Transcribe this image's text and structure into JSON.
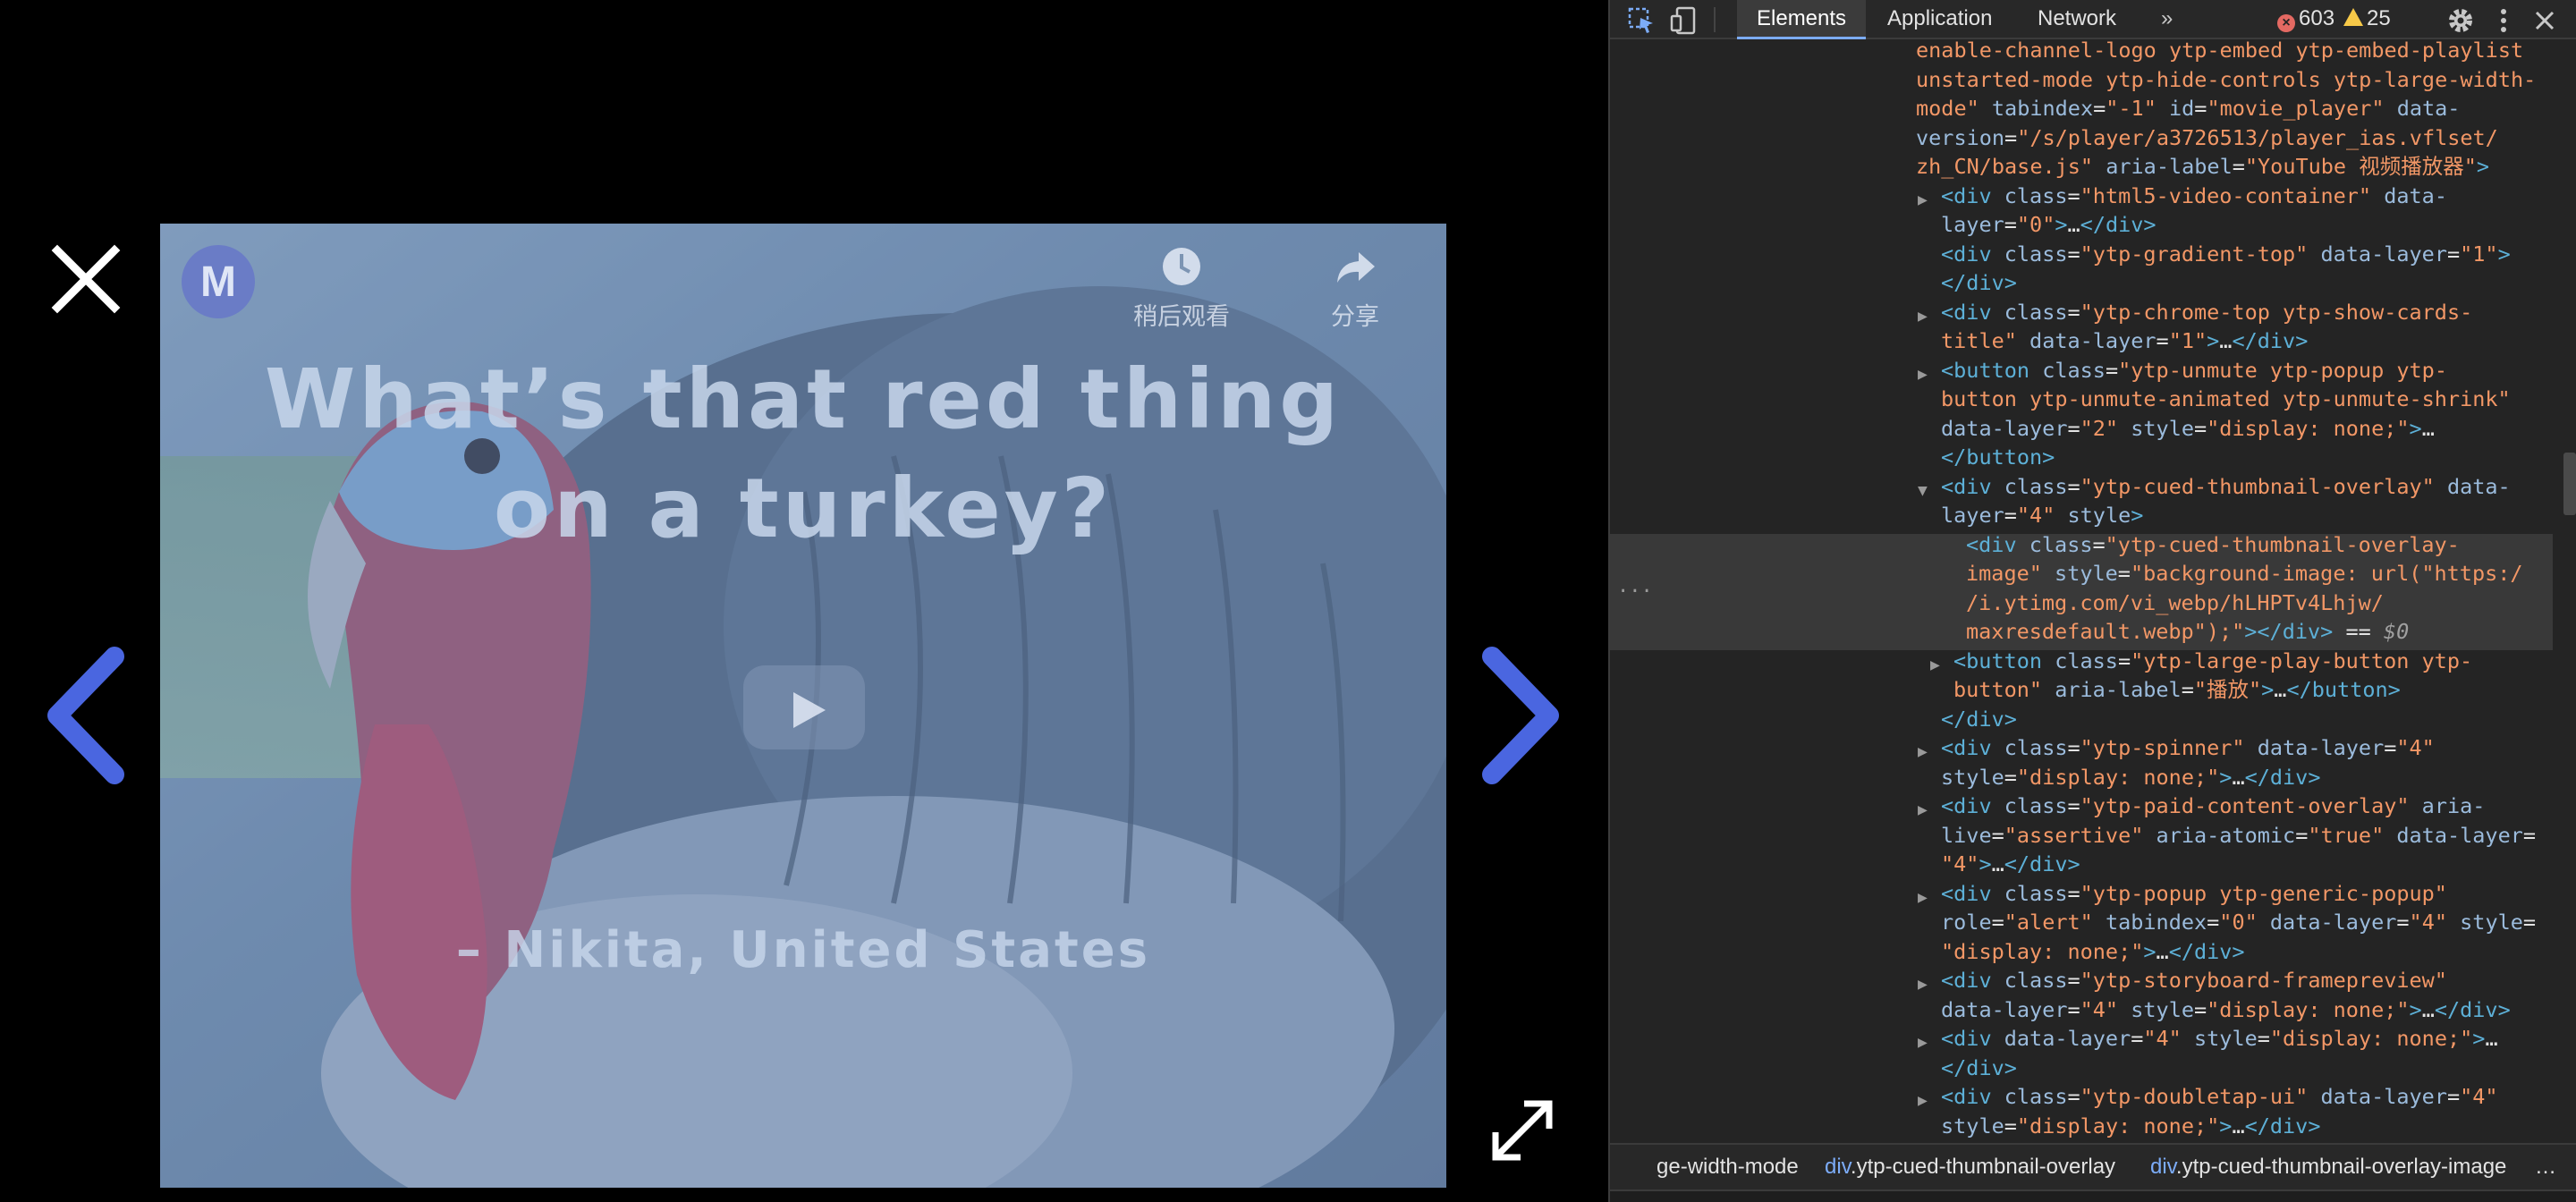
{
  "lightbox": {
    "video": {
      "title_line1": "What’s that red thing",
      "title_line2": "on a turkey?",
      "author": "– Nikita, United States",
      "channel_logo_letter": "M",
      "watch_later_label": "稍后观看",
      "share_label": "分享"
    },
    "icons": {
      "close": "close-icon",
      "prev": "chevron-left-icon",
      "next": "chevron-right-icon",
      "expand": "expand-icon",
      "watch_later": "clock-icon",
      "share": "share-icon",
      "play": "play-icon"
    },
    "colors": {
      "nav_accent": "#4a66e0",
      "close": "#ffffff"
    }
  },
  "devtools": {
    "tabs": [
      "Elements",
      "Application",
      "Network"
    ],
    "more_tabs": "»",
    "error_count": "603",
    "warning_count": "25",
    "lines": [
      {
        "html": "<span class='v'>enable-channel-logo ytp-embed ytp-embed-playlist</span>"
      },
      {
        "html": "<span class='v'>unstarted-mode ytp-hide-controls ytp-large-width-</span>"
      },
      {
        "html": "<span class='v'>mode\"</span> <span class='a'>tabindex</span><span class='p'>=</span><span class='v'>\"-1\"</span> <span class='a'>id</span><span class='p'>=</span><span class='v'>\"movie_player\"</span> <span class='a'>data-</span>"
      },
      {
        "html": "<span class='a'>version</span><span class='p'>=</span><span class='v'>\"/s/player/a3726513/player_ias.vflset/</span>"
      },
      {
        "html": "<span class='v'>zh_CN/base.js\"</span> <span class='a'>aria-label</span><span class='p'>=</span><span class='v'>\"YouTube 视频播放器\"</span><span class='t'>&gt;</span>"
      },
      {
        "html": "<span class='t'>&lt;div</span> <span class='a'>class</span><span class='p'>=</span><span class='v'>\"html5-video-container\"</span> <span class='a'>data-</span>"
      },
      {
        "html": "<span class='a'>layer</span><span class='p'>=</span><span class='v'>\"0\"</span><span class='t'>&gt;</span><span class='p'>…</span><span class='t'>&lt;/div&gt;</span>"
      },
      {
        "html": "<span class='t'>&lt;div</span> <span class='a'>class</span><span class='p'>=</span><span class='v'>\"ytp-gradient-top\"</span> <span class='a'>data-layer</span><span class='p'>=</span><span class='v'>\"1\"</span><span class='t'>&gt;</span>"
      },
      {
        "html": "<span class='t'>&lt;/div&gt;</span>"
      },
      {
        "html": "<span class='t'>&lt;div</span> <span class='a'>class</span><span class='p'>=</span><span class='v'>\"ytp-chrome-top ytp-show-cards-</span>"
      },
      {
        "html": "<span class='v'>title\"</span> <span class='a'>data-layer</span><span class='p'>=</span><span class='v'>\"1\"</span><span class='t'>&gt;</span><span class='p'>…</span><span class='t'>&lt;/div&gt;</span>"
      },
      {
        "html": "<span class='t'>&lt;button</span> <span class='a'>class</span><span class='p'>=</span><span class='v'>\"ytp-unmute ytp-popup ytp-</span>"
      },
      {
        "html": "<span class='v'>button ytp-unmute-animated ytp-unmute-shrink\"</span>"
      },
      {
        "html": "<span class='a'>data-layer</span><span class='p'>=</span><span class='v'>\"2\"</span> <span class='a'>style</span><span class='p'>=</span><span class='v'>\"display: none;\"</span><span class='t'>&gt;</span><span class='p'>…</span>"
      },
      {
        "html": "<span class='t'>&lt;/button&gt;</span>"
      },
      {
        "html": "<span class='t'>&lt;div</span> <span class='a'>class</span><span class='p'>=</span><span class='v'>\"ytp-cued-thumbnail-overlay\"</span> <span class='a'>data-</span>"
      },
      {
        "html": "<span class='a'>layer</span><span class='p'>=</span><span class='v'>\"4\"</span> <span class='a'>style</span><span class='t'>&gt;</span>"
      },
      {
        "html": "<span class='t'>&lt;div</span> <span class='a'>class</span><span class='p'>=</span><span class='v'>\"ytp-cued-thumbnail-overlay-</span>"
      },
      {
        "html": "<span class='v'>image\"</span> <span class='a'>style</span><span class='p'>=</span><span class='v'>\"background-image: url(\"https:/</span>"
      },
      {
        "html": "<span class='v'>/i.ytimg.com/vi_webp/hLHPTv4Lhjw/</span>"
      },
      {
        "html": "<span class='v'>maxresdefault.webp\");\"</span><span class='t'>&gt;&lt;/div&gt;</span> <span class='p'>==</span> <span class='g'>$0</span>"
      },
      {
        "html": "<span class='t'>&lt;button</span> <span class='a'>class</span><span class='p'>=</span><span class='v'>\"ytp-large-play-button ytp-</span>"
      },
      {
        "html": "<span class='v'>button\"</span> <span class='a'>aria-label</span><span class='p'>=</span><span class='v'>\"播放\"</span><span class='t'>&gt;</span><span class='p'>…</span><span class='t'>&lt;/button&gt;</span>"
      },
      {
        "html": "<span class='t'>&lt;/div&gt;</span>"
      },
      {
        "html": "<span class='t'>&lt;div</span> <span class='a'>class</span><span class='p'>=</span><span class='v'>\"ytp-spinner\"</span> <span class='a'>data-layer</span><span class='p'>=</span><span class='v'>\"4\"</span>"
      },
      {
        "html": "<span class='a'>style</span><span class='p'>=</span><span class='v'>\"display: none;\"</span><span class='t'>&gt;</span><span class='p'>…</span><span class='t'>&lt;/div&gt;</span>"
      },
      {
        "html": "<span class='t'>&lt;div</span> <span class='a'>class</span><span class='p'>=</span><span class='v'>\"ytp-paid-content-overlay\"</span> <span class='a'>aria-</span>"
      },
      {
        "html": "<span class='a'>live</span><span class='p'>=</span><span class='v'>\"assertive\"</span> <span class='a'>aria-atomic</span><span class='p'>=</span><span class='v'>\"true\"</span> <span class='a'>data-layer</span><span class='p'>=</span>"
      },
      {
        "html": "<span class='v'>\"4\"</span><span class='t'>&gt;</span><span class='p'>…</span><span class='t'>&lt;/div&gt;</span>"
      },
      {
        "html": "<span class='t'>&lt;div</span> <span class='a'>class</span><span class='p'>=</span><span class='v'>\"ytp-popup ytp-generic-popup\"</span>"
      },
      {
        "html": "<span class='a'>role</span><span class='p'>=</span><span class='v'>\"alert\"</span> <span class='a'>tabindex</span><span class='p'>=</span><span class='v'>\"0\"</span> <span class='a'>data-layer</span><span class='p'>=</span><span class='v'>\"4\"</span> <span class='a'>style</span><span class='p'>=</span>"
      },
      {
        "html": "<span class='v'>\"display: none;\"</span><span class='t'>&gt;</span><span class='p'>…</span><span class='t'>&lt;/div&gt;</span>"
      },
      {
        "html": "<span class='t'>&lt;div</span> <span class='a'>class</span><span class='p'>=</span><span class='v'>\"ytp-storyboard-framepreview\"</span>"
      },
      {
        "html": "<span class='a'>data-layer</span><span class='p'>=</span><span class='v'>\"4\"</span> <span class='a'>style</span><span class='p'>=</span><span class='v'>\"display: none;\"</span><span class='t'>&gt;</span><span class='p'>…</span><span class='t'>&lt;/div&gt;</span>"
      },
      {
        "html": "<span class='t'>&lt;div</span> <span class='a'>data-layer</span><span class='p'>=</span><span class='v'>\"4\"</span> <span class='a'>style</span><span class='p'>=</span><span class='v'>\"display: none;\"</span><span class='t'>&gt;</span><span class='p'>…</span>"
      },
      {
        "html": "<span class='t'>&lt;/div&gt;</span>"
      },
      {
        "html": "<span class='t'>&lt;div</span> <span class='a'>class</span><span class='p'>=</span><span class='v'>\"ytp-doubletap-ui\"</span> <span class='a'>data-layer</span><span class='p'>=</span><span class='v'>\"4\"</span>"
      },
      {
        "html": "<span class='a'>style</span><span class='p'>=</span><span class='v'>\"display: none;\"</span><span class='t'>&gt;</span><span class='p'>…</span><span class='t'>&lt;/div&gt;</span>"
      }
    ],
    "breadcrumbs": [
      {
        "tag": "",
        "cls": "ge-width-mode"
      },
      {
        "tag": "div",
        "cls": ".ytp-cued-thumbnail-overlay"
      },
      {
        "tag": "div",
        "cls": ".ytp-cued-thumbnail-overlay-image"
      }
    ],
    "breadcrumb_more": "…",
    "gutter_dots": "···"
  }
}
